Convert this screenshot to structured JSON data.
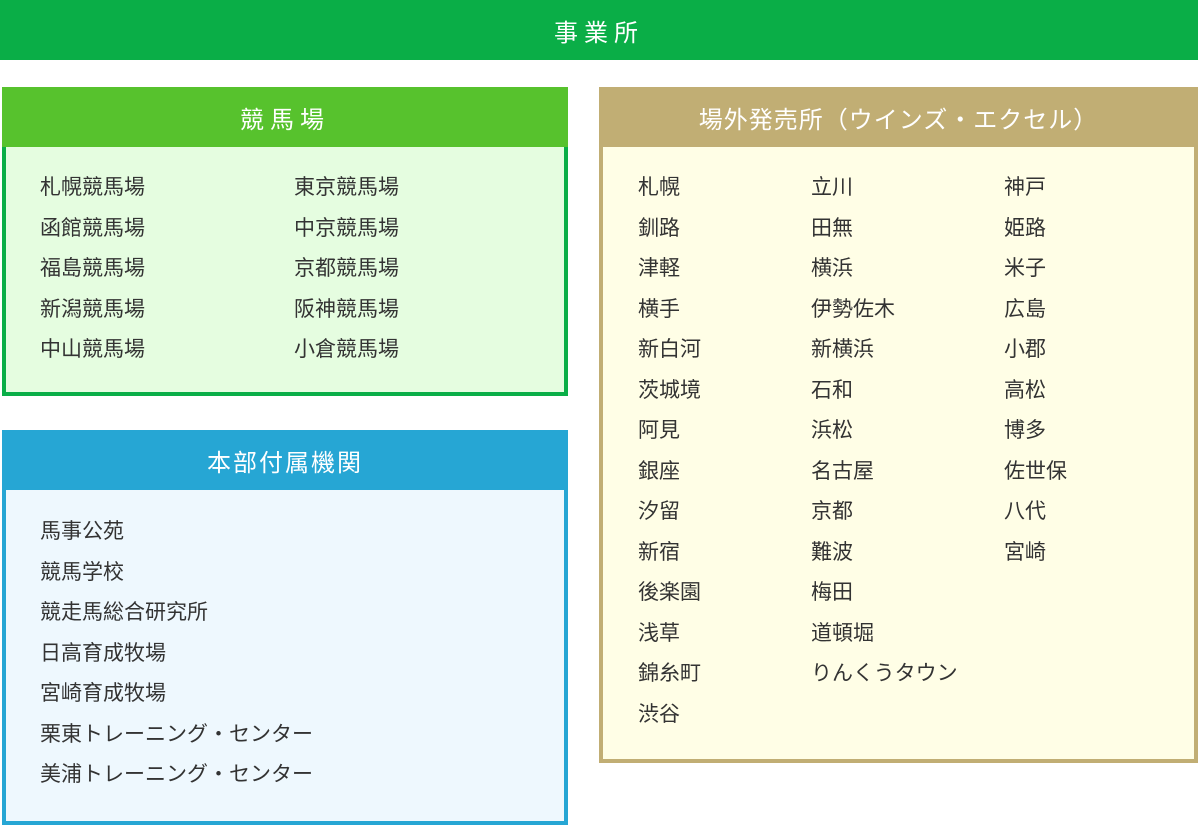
{
  "header": {
    "title": "事業所"
  },
  "racecourses": {
    "title": "競馬場",
    "columns": [
      [
        "札幌競馬場",
        "函館競馬場",
        "福島競馬場",
        "新潟競馬場",
        "中山競馬場"
      ],
      [
        "東京競馬場",
        "中京競馬場",
        "京都競馬場",
        "阪神競馬場",
        "小倉競馬場"
      ]
    ]
  },
  "affiliates": {
    "title": "本部付属機関",
    "items": [
      "馬事公苑",
      "競馬学校",
      "競走馬総合研究所",
      "日高育成牧場",
      "宮崎育成牧場",
      "栗東トレーニング・センター",
      "美浦トレーニング・センター"
    ]
  },
  "offtrack": {
    "title": "場外発売所（ウインズ・エクセル）",
    "columns": [
      [
        "札幌",
        "釧路",
        "津軽",
        "横手",
        "新白河",
        "茨城境",
        "阿見",
        "銀座",
        "汐留",
        "新宿",
        "後楽園",
        "浅草",
        "錦糸町",
        "渋谷"
      ],
      [
        "立川",
        "田無",
        "横浜",
        "伊勢佐木",
        "新横浜",
        "石和",
        "浜松",
        "名古屋",
        "京都",
        "難波",
        "梅田",
        "道頓堀",
        "りんくうタウン"
      ],
      [
        "神戸",
        "姫路",
        "米子",
        "広島",
        "小郡",
        "高松",
        "博多",
        "佐世保",
        "八代",
        "宮崎"
      ]
    ]
  },
  "colors": {
    "header": "#0aae47",
    "racecourses_title": "#57c22d",
    "racecourses_border": "#0aae47",
    "racecourses_bg": "#e5fde0",
    "affiliates_title": "#26a6d4",
    "affiliates_bg": "#eef8fe",
    "offtrack_title": "#c1ae74",
    "offtrack_bg": "#fffee6"
  }
}
